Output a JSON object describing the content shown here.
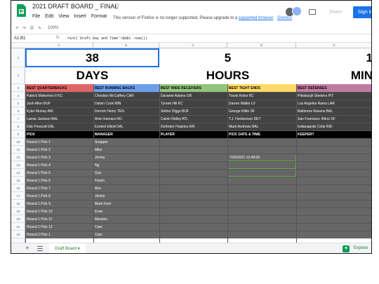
{
  "doc": {
    "title": "2021 DRAFT BOARD _ FINAL",
    "menu": [
      "File",
      "Edit",
      "View",
      "Insert",
      "Format"
    ],
    "banner_text": "This version of Firefox is no longer supported. Please upgrade to a",
    "banner_link": "supported browser",
    "banner_dismiss": "Dismiss",
    "share_label": "Share",
    "signin_label": "Sign in"
  },
  "toolbar": {
    "zoom": "100%"
  },
  "formula": {
    "namebox": "A1:B1",
    "fx": "fx",
    "text": "=int(`Draft Day and Time'!$A$3 -now())"
  },
  "columns": [
    "A",
    "B",
    "C",
    "D",
    "E"
  ],
  "rows": [
    "1",
    "2",
    "3",
    "4",
    "5",
    "6",
    "7",
    "8",
    "9",
    "10",
    "11",
    "12",
    "13",
    "14",
    "15",
    "16",
    "17",
    "18",
    "19",
    "20",
    "21",
    "22"
  ],
  "countdown": {
    "days_value": "38",
    "days_label": "DAYS",
    "hours_value": "5",
    "hours_label": "HOURS",
    "mins_value": "1",
    "mins_label": "MIN"
  },
  "best_headers": [
    "BEST QUARTERBACKS",
    "BEST RUNNING BACKS",
    "BEST WIDE RECEIVERS",
    "BEST TIGHT ENDS",
    "BEST DEFENSES"
  ],
  "header_colors": [
    "#e06666",
    "#6d9eeb",
    "#93c47d",
    "#ffd966",
    "#c27ba0"
  ],
  "best_rows": [
    [
      "Patrick Mahomes II  KC",
      "Christian McCaffrey  CAR",
      "Davante Adams  GB",
      "Travis Kelce  KC",
      "Pittsburgh Steelers  PIT"
    ],
    [
      "Josh Allen  BUF",
      "Dalvin Cook  MIN",
      "Tyreek Hill  KC",
      "Darren Waller  LV",
      "Los Angeles Rams  LAR"
    ],
    [
      "Kyler Murray  ARI",
      "Derrick Henry  TEN",
      "Stefon Diggs  BUF",
      "George Kittle  SF",
      "Baltimore Ravens  BAL"
    ],
    [
      "Lamar Jackson  BAL",
      "Alvin Kamara  NO",
      "Calvin Ridley  ATL",
      "T.J. Hockenson  DET",
      "San Francisco 49ers  SF"
    ],
    [
      "Dak Prescott  DAL",
      "Ezekiel Elliott  DAL",
      "DeAndre Hopkins  ARI",
      "Mark Andrews  BAL",
      "Indianapolis Colts  IND"
    ]
  ],
  "pick_headers": [
    "PICK",
    "MANAGER",
    "PLAYER",
    "PICK DATE & TIME",
    "KEEPER?"
  ],
  "picks": [
    {
      "pick": "Round 1 Pick 1",
      "manager": "Snapper",
      "player": "",
      "time": "",
      "keeper": ""
    },
    {
      "pick": "Round 1 Pick 2",
      "manager": "Mike",
      "player": "",
      "time": "",
      "keeper": ""
    },
    {
      "pick": "Round 1 Pick 3",
      "manager": "Jimmy",
      "player": "",
      "time": "7/30/2021 12:49:06",
      "keeper": ""
    },
    {
      "pick": "Round 1 Pick 4",
      "manager": "Ng",
      "player": "",
      "time": "",
      "keeper": ""
    },
    {
      "pick": "Round 1 Pick 5",
      "manager": "Gus",
      "player": "",
      "time": "",
      "keeper": ""
    },
    {
      "pick": "Round 1 Pick 6",
      "manager": "Fooch",
      "player": "",
      "time": "",
      "keeper": ""
    },
    {
      "pick": "Round 1 Pick 7",
      "manager": "Ben",
      "player": "",
      "time": "",
      "keeper": ""
    },
    {
      "pick": "Round 1 Pick 8",
      "manager": "Jimmy",
      "player": "",
      "time": "",
      "keeper": ""
    },
    {
      "pick": "Round 1 Pick 9",
      "manager": "Mark Ford",
      "player": "",
      "time": "",
      "keeper": ""
    },
    {
      "pick": "Round 1 Pick 10",
      "manager": "Evan",
      "player": "",
      "time": "",
      "keeper": ""
    },
    {
      "pick": "Round 1 Pick 11",
      "manager": "Marston",
      "player": "",
      "time": "",
      "keeper": ""
    },
    {
      "pick": "Round 1 Pick 12",
      "manager": "Cam",
      "player": "",
      "time": "",
      "keeper": ""
    },
    {
      "pick": "Round 2 Pick 1",
      "manager": "Cam",
      "player": "",
      "time": "",
      "keeper": ""
    }
  ],
  "sheetbar": {
    "add": "+",
    "tab": "Draft Board",
    "explore": "Explore"
  }
}
